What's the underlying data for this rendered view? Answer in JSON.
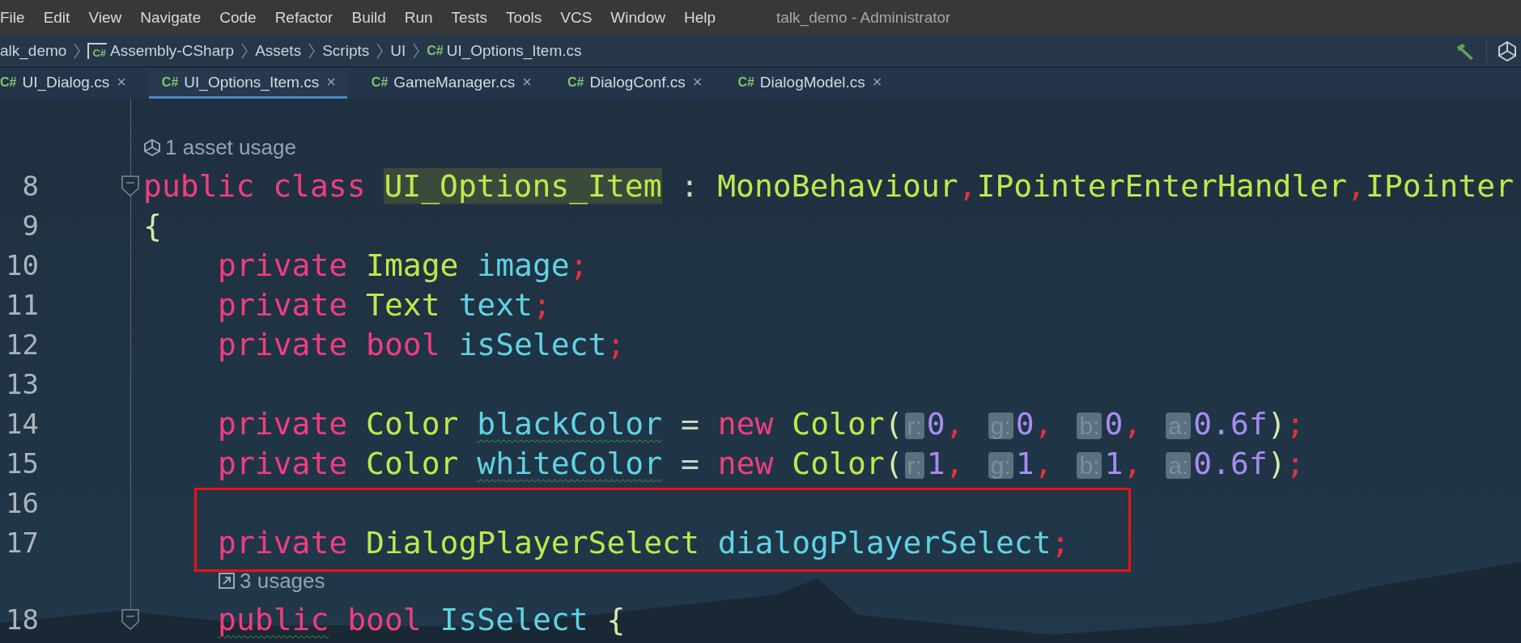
{
  "menu_bar": {
    "items": [
      "File",
      "Edit",
      "View",
      "Navigate",
      "Code",
      "Refactor",
      "Build",
      "Run",
      "Tests",
      "Tools",
      "VCS",
      "Window",
      "Help"
    ],
    "window_title": "talk_demo - Administrator"
  },
  "breadcrumb": [
    {
      "label": "alk_demo",
      "kind": "project"
    },
    {
      "label": "Assembly-CSharp",
      "badge": "C#",
      "kind": "assembly"
    },
    {
      "label": "Assets",
      "kind": "folder"
    },
    {
      "label": "Scripts",
      "kind": "folder"
    },
    {
      "label": "UI",
      "kind": "folder"
    },
    {
      "label": "UI_Options_Item.cs",
      "badge": "C#",
      "kind": "file"
    }
  ],
  "tabs": [
    {
      "badge": "C#",
      "label": "UI_Dialog.cs",
      "close": "×",
      "selected": false
    },
    {
      "badge": "C#",
      "label": "UI_Options_Item.cs",
      "close": "×",
      "selected": true
    },
    {
      "badge": "C#",
      "label": "GameManager.cs",
      "close": "×",
      "selected": false
    },
    {
      "badge": "C#",
      "label": "DialogConf.cs",
      "close": "×",
      "selected": false
    },
    {
      "badge": "C#",
      "label": "DialogModel.cs",
      "close": "×",
      "selected": false
    }
  ],
  "editor": {
    "lines": [
      {
        "kind": "asset-hint",
        "text": "1 asset usage"
      },
      {
        "kind": "code",
        "number": "8",
        "fold": true,
        "tokens": [
          {
            "kind": "kw",
            "s": "public class "
          },
          {
            "kind": "decl",
            "s": "UI_Options_Item"
          },
          {
            "kind": "plain",
            "s": " : "
          },
          {
            "kind": "type",
            "s": "MonoBehaviour"
          },
          {
            "kind": "punct",
            "s": ","
          },
          {
            "kind": "type",
            "s": "IPointerEnterHandler"
          },
          {
            "kind": "punct",
            "s": ","
          },
          {
            "kind": "type",
            "s": "IPointer"
          }
        ]
      },
      {
        "kind": "code",
        "number": "9",
        "fold": false,
        "tokens": [
          {
            "kind": "brace",
            "s": "{"
          }
        ]
      },
      {
        "kind": "member",
        "number": "10",
        "fold": false,
        "tokens": [
          {
            "kind": "kw",
            "s": "private "
          },
          {
            "kind": "type",
            "s": "Image "
          },
          {
            "kind": "field",
            "s": "image"
          },
          {
            "kind": "punct",
            "s": ";"
          }
        ]
      },
      {
        "kind": "member",
        "number": "11",
        "fold": false,
        "tokens": [
          {
            "kind": "kw",
            "s": "private "
          },
          {
            "kind": "type",
            "s": "Text "
          },
          {
            "kind": "field",
            "s": "text"
          },
          {
            "kind": "punct",
            "s": ";"
          }
        ]
      },
      {
        "kind": "member",
        "number": "12",
        "fold": false,
        "tokens": [
          {
            "kind": "kw",
            "s": "private bool "
          },
          {
            "kind": "field",
            "s": "isSelect"
          },
          {
            "kind": "punct",
            "s": ";"
          }
        ]
      },
      {
        "kind": "member",
        "number": "13",
        "fold": false
      },
      {
        "kind": "member",
        "number": "14",
        "fold": false,
        "tokens": [
          {
            "kind": "kw",
            "s": "private "
          },
          {
            "kind": "type",
            "s": "Color "
          },
          {
            "kind": "field-warn",
            "s": "blackColor"
          },
          {
            "kind": "plain",
            "s": " = "
          },
          {
            "kind": "kw",
            "s": "new "
          },
          {
            "kind": "type",
            "s": "Color"
          },
          {
            "kind": "brace",
            "s": "("
          },
          {
            "kind": "inlay",
            "s": "r:"
          },
          {
            "kind": "num",
            "s": "0"
          },
          {
            "kind": "punct",
            "s": ","
          },
          {
            "kind": "inlay",
            "s": "g:"
          },
          {
            "kind": "num",
            "s": "0"
          },
          {
            "kind": "punct",
            "s": ","
          },
          {
            "kind": "inlay",
            "s": "b:"
          },
          {
            "kind": "num",
            "s": "0"
          },
          {
            "kind": "punct",
            "s": ","
          },
          {
            "kind": "inlay",
            "s": "a:"
          },
          {
            "kind": "num",
            "s": "0.6f"
          },
          {
            "kind": "brace",
            "s": ")"
          },
          {
            "kind": "punct",
            "s": ";"
          }
        ]
      },
      {
        "kind": "member",
        "number": "15",
        "fold": false,
        "tokens": [
          {
            "kind": "kw",
            "s": "private "
          },
          {
            "kind": "type",
            "s": "Color "
          },
          {
            "kind": "field-warn",
            "s": "whiteColor"
          },
          {
            "kind": "plain",
            "s": " = "
          },
          {
            "kind": "kw",
            "s": "new "
          },
          {
            "kind": "type",
            "s": "Color"
          },
          {
            "kind": "brace",
            "s": "("
          },
          {
            "kind": "inlay",
            "s": "r:"
          },
          {
            "kind": "num",
            "s": "1"
          },
          {
            "kind": "punct",
            "s": ","
          },
          {
            "kind": "inlay",
            "s": "g:"
          },
          {
            "kind": "num",
            "s": "1"
          },
          {
            "kind": "punct",
            "s": ","
          },
          {
            "kind": "inlay",
            "s": "b:"
          },
          {
            "kind": "num",
            "s": "1"
          },
          {
            "kind": "punct",
            "s": ","
          },
          {
            "kind": "inlay",
            "s": "a:"
          },
          {
            "kind": "num",
            "s": "0.6f"
          },
          {
            "kind": "brace",
            "s": ")"
          },
          {
            "kind": "punct",
            "s": ";"
          }
        ]
      },
      {
        "kind": "member",
        "number": "16",
        "fold": false
      },
      {
        "kind": "member",
        "number": "17",
        "fold": false,
        "tokens": [
          {
            "kind": "kw",
            "s": "private "
          },
          {
            "kind": "type",
            "s": "DialogPlayerSelect "
          },
          {
            "kind": "field",
            "s": "dialogPlayerSelect"
          },
          {
            "kind": "punct",
            "s": ";"
          }
        ]
      },
      {
        "kind": "usages-hint",
        "text": "3 usages"
      },
      {
        "kind": "member",
        "number": "18",
        "fold": true,
        "tokens": [
          {
            "kind": "kw-warn",
            "s": "public"
          },
          {
            "kind": "kw",
            "s": " bool "
          },
          {
            "kind": "field",
            "s": "IsSelect"
          },
          {
            "kind": "brace",
            "s": " {"
          }
        ]
      }
    ]
  }
}
